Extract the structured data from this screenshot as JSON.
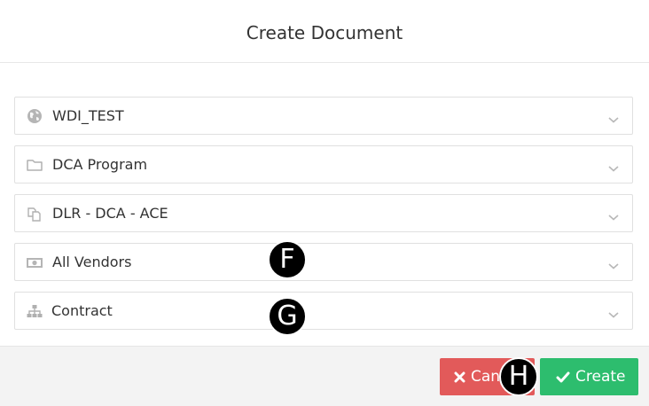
{
  "dialog": {
    "title": "Create Document"
  },
  "fields": [
    {
      "label": "WDI_TEST",
      "icon": "globe-icon"
    },
    {
      "label": "DCA Program",
      "icon": "folder-icon"
    },
    {
      "label": "DLR - DCA - ACE",
      "icon": "copy-files-icon"
    },
    {
      "label": "All Vendors",
      "icon": "money-icon"
    },
    {
      "label": "Contract",
      "icon": "sitemap-icon"
    }
  ],
  "buttons": {
    "cancel_label": "Cancel",
    "create_label": "Create"
  },
  "markers": {
    "f": "F",
    "g": "G",
    "h": "H"
  },
  "colors": {
    "cancel": "#e25a5a",
    "create": "#2dbd6e",
    "icon": "#b0b0b0",
    "footer": "#f3f3f3"
  }
}
